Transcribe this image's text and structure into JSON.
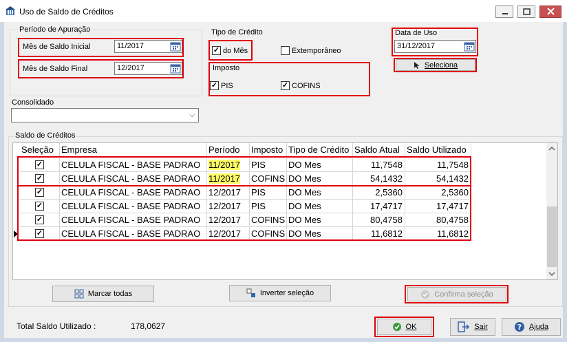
{
  "window": {
    "title": "Uso de Saldo de Créditos",
    "icon": "building-icon",
    "controls": [
      "minimize",
      "maximize",
      "close"
    ]
  },
  "periodo": {
    "label": "Período de Apuração",
    "inicial": {
      "label": "Mês de Saldo Inicial",
      "value": "11/2017"
    },
    "final": {
      "label": "Mês de Saldo Final",
      "value": "12/2017"
    }
  },
  "tipo_credito": {
    "label": "Tipo de Crédito",
    "do_mes": {
      "label": "do Mês",
      "checked": true
    },
    "extemporaneo": {
      "label": "Extemporâneo",
      "checked": false
    }
  },
  "imposto": {
    "label": "Imposto",
    "pis": {
      "label": "PIS",
      "checked": true
    },
    "cofins": {
      "label": "COFINS",
      "checked": true
    }
  },
  "data_uso": {
    "label": "Data de Uso",
    "value": "31/12/2017"
  },
  "seleciona_button": "Seleciona",
  "consolidado": {
    "label": "Consolidado",
    "value": ""
  },
  "saldo": {
    "label": "Saldo de Créditos",
    "columns": [
      "Seleção",
      "Empresa",
      "Período",
      "Imposto",
      "Tipo de Crédito",
      "Saldo Atual",
      "Saldo Utilizado"
    ],
    "rows": [
      {
        "selected": true,
        "empresa": "CELULA FISCAL - BASE PADRAO",
        "periodo": "11/2017",
        "imposto": "PIS",
        "tipo": "DO Mes",
        "saldo_atual": "11,7548",
        "saldo_utilizado": "11,7548"
      },
      {
        "selected": true,
        "empresa": "CELULA FISCAL - BASE PADRAO",
        "periodo": "11/2017",
        "imposto": "COFINS",
        "tipo": "DO Mes",
        "saldo_atual": "54,1432",
        "saldo_utilizado": "54,1432"
      },
      {
        "selected": true,
        "empresa": "CELULA FISCAL - BASE PADRAO",
        "periodo": "12/2017",
        "imposto": "PIS",
        "tipo": "DO Mes",
        "saldo_atual": "2,5360",
        "saldo_utilizado": "2,5360"
      },
      {
        "selected": true,
        "empresa": "CELULA FISCAL - BASE PADRAO",
        "periodo": "12/2017",
        "imposto": "PIS",
        "tipo": "DO Mes",
        "saldo_atual": "17,4717",
        "saldo_utilizado": "17,4717"
      },
      {
        "selected": true,
        "empresa": "CELULA FISCAL - BASE PADRAO",
        "periodo": "12/2017",
        "imposto": "COFINS",
        "tipo": "DO Mes",
        "saldo_atual": "80,4758",
        "saldo_utilizado": "80,4758"
      },
      {
        "selected": true,
        "empresa": "CELULA FISCAL - BASE PADRAO",
        "periodo": "12/2017",
        "imposto": "COFINS",
        "tipo": "DO Mes",
        "saldo_atual": "11,6812",
        "saldo_utilizado": "11,6812"
      }
    ]
  },
  "buttons": {
    "marcar_todas": "Marcar todas",
    "inverter": "Inverter seleção",
    "confirma": "Confirma seleção",
    "ok": "OK",
    "sair": "Sair",
    "ajuda": "Ajuda"
  },
  "total": {
    "label": "Total Saldo Utilizado :",
    "value": "178,0627"
  },
  "colors": {
    "highlight": "#ffff66",
    "annotation_red": "#e0000c",
    "check_green": "#3c9a3c"
  }
}
